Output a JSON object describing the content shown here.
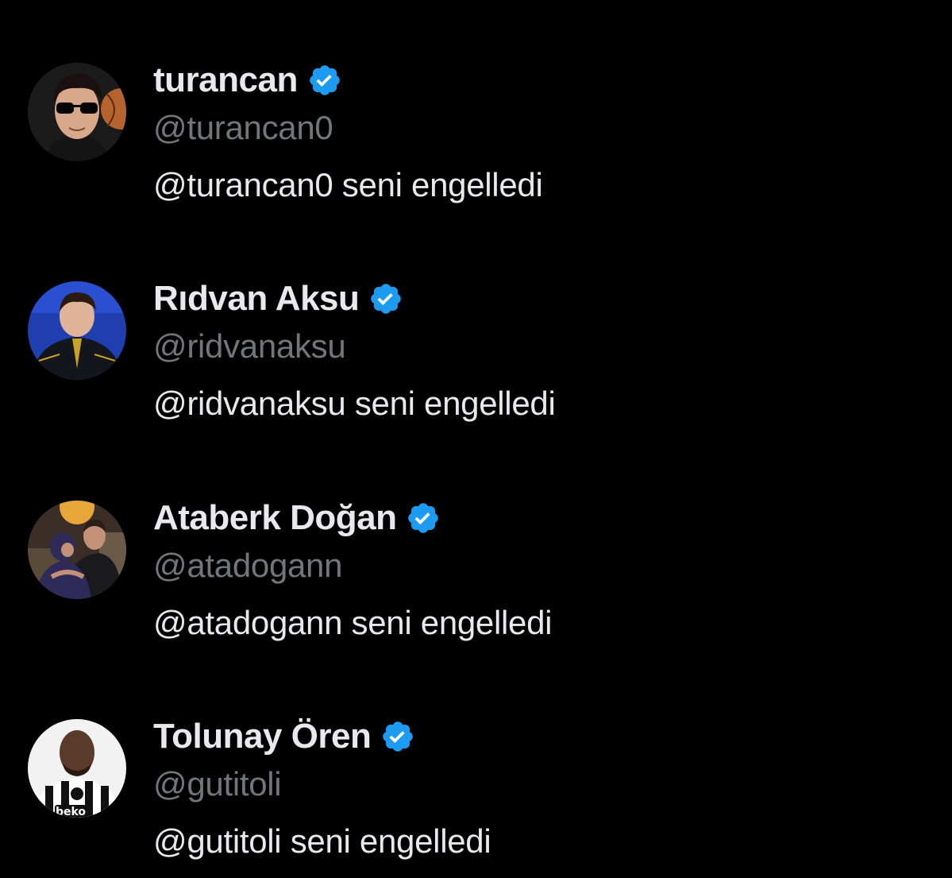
{
  "colors": {
    "background": "#000000",
    "text_primary": "#e7e9ea",
    "text_secondary": "#71767b",
    "verified_badge": "#1d9bf0"
  },
  "notifications": [
    {
      "name": "turancan",
      "handle": "@turancan0",
      "message": "@turancan0 seni engelledi",
      "verified": true,
      "avatar_icon": "person-sunglasses-avatar"
    },
    {
      "name": "Rıdvan Aksu",
      "handle": "@ridvanaksu",
      "message": "@ridvanaksu seni engelledi",
      "verified": true,
      "avatar_icon": "person-blue-background-avatar"
    },
    {
      "name": "Ataberk Doğan",
      "handle": "@atadogann",
      "message": "@atadogann seni engelledi",
      "verified": true,
      "avatar_icon": "people-hugging-avatar"
    },
    {
      "name": "Tolunay Ören",
      "handle": "@gutitoli",
      "message": "@gutitoli seni engelledi",
      "verified": true,
      "avatar_icon": "footballer-striped-jersey-avatar",
      "jersey_logo_text": "beko"
    }
  ]
}
